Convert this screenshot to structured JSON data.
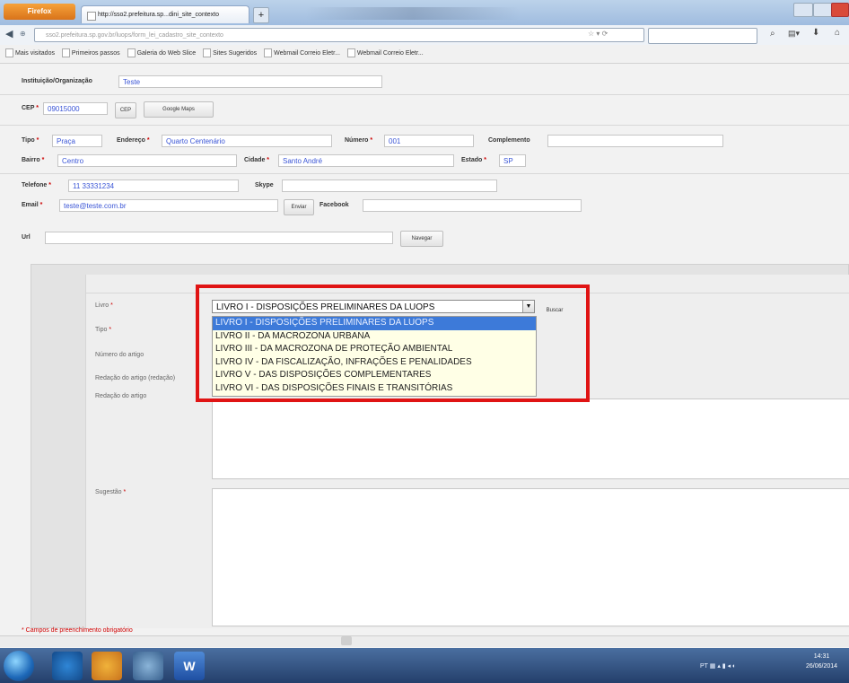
{
  "browser": {
    "app_button": "Firefox",
    "tab_title": "http://sso2.prefeitura.sp...dini_site_contexto",
    "url": "sso2.prefeitura.sp.gov.br/luops/form_lei_cadastro_site_contexto",
    "bookmarks": [
      "Mais visitados",
      "Primeiros passos",
      "Galeria do Web Slice",
      "Sites Sugeridos",
      "Webmail Correio Eletr...",
      "Webmail Correio Eletr..."
    ]
  },
  "form": {
    "org_label": "Instituição/Organização",
    "org_value": "Teste",
    "cep_label": "CEP",
    "cep_value": "09015000",
    "cep_button": "CEP",
    "maps_button": "Google Maps",
    "tipo_label": "Tipo",
    "tipo_value": "Praça",
    "endereco_label": "Endereço",
    "endereco_value": "Quarto Centenário",
    "numero_label": "Número",
    "numero_value": "001",
    "complemento_label": "Complemento",
    "complemento_value": "",
    "bairro_label": "Bairro",
    "bairro_value": "Centro",
    "cidade_label": "Cidade",
    "cidade_value": "Santo André",
    "estado_label": "Estado",
    "estado_value": "SP",
    "telefone_label": "Telefone",
    "telefone_value": "11 33331234",
    "skype_label": "Skype",
    "skype_value": "",
    "email_label": "Email",
    "email_value": "teste@teste.com.br",
    "enviar_button": "Enviar",
    "facebook_label": "Facebook",
    "facebook_value": "",
    "url_label": "Url",
    "url_value": "",
    "navegar_button": "Navegar"
  },
  "subform": {
    "livro_label": "Livro",
    "tipo_label": "Tipo",
    "numero_artigo_label": "Número do artigo",
    "redacao_redacao_label": "Redação do artigo (redação)",
    "redacao_artigo_label": "Redação do artigo",
    "sugestao_label": "Sugestão",
    "buscar_button": "Buscar",
    "selected": "LIVRO I - DISPOSIÇÕES PRELIMINARES DA LUOPS",
    "options": [
      "LIVRO I - DISPOSIÇÕES PRELIMINARES DA LUOPS",
      "LIVRO II - DA MACROZONA URBANA",
      "LIVRO III - DA MACROZONA DE PROTEÇÃO AMBIENTAL",
      "LIVRO IV - DA FISCALIZAÇÃO, INFRAÇÕES E PENALIDADES",
      "LIVRO V - DAS DISPOSIÇÕES COMPLEMENTARES",
      "LIVRO VI - DAS DISPOSIÇÕES FINAIS E TRANSITÓRIAS"
    ]
  },
  "footnote": "* Campos de preenchimento obrigatório",
  "taskbar": {
    "time": "14:31",
    "date": "26/06/2014",
    "tray": "PT"
  },
  "colors": {
    "highlight_box": "#e01414",
    "selected_option": "#3d7ad9",
    "field_text": "#3a55d6",
    "required_mark": "#cc0000"
  }
}
